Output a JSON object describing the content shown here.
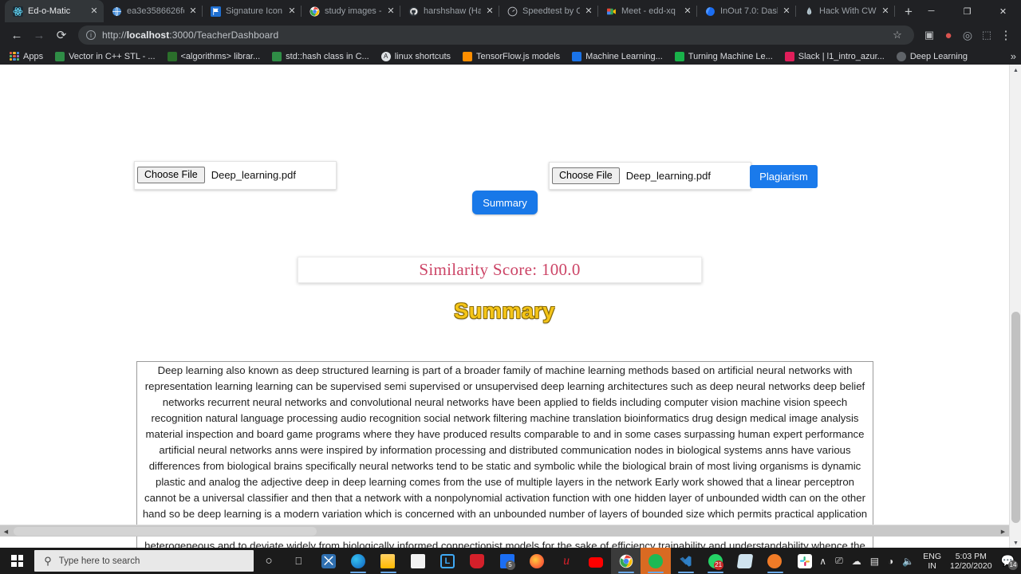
{
  "browser": {
    "tabs": [
      {
        "title": "Ed-o-Matic",
        "favicon": "react-atom-icon",
        "color": "#61dafb",
        "active": true
      },
      {
        "title": "ea3e3586626fc",
        "favicon": "globe-icon",
        "color": "#4a90d9",
        "active": false
      },
      {
        "title": "Signature Icon",
        "favicon": "flag-icon",
        "color": "#1f6fd0",
        "active": false
      },
      {
        "title": "study images -",
        "favicon": "chrome-icon",
        "color": "#4285f4",
        "active": false
      },
      {
        "title": "harshshaw (Ha",
        "favicon": "github-icon",
        "color": "#e0e0e0",
        "active": false
      },
      {
        "title": "Speedtest by O",
        "favicon": "speedtest-icon",
        "color": "#b0b3b8",
        "active": false
      },
      {
        "title": "Meet - edd-xq",
        "favicon": "meet-icon",
        "color": "#ea4335",
        "active": false
      },
      {
        "title": "InOut 7.0: Dash",
        "favicon": "inout-icon",
        "color": "#1b6ef3",
        "active": false
      },
      {
        "title": "Hack With CW",
        "favicon": "hack-icon",
        "color": "#b6c7cf",
        "active": false
      }
    ],
    "new_tab_label": "+",
    "window_controls": {
      "minimize": "─",
      "maximize": "❐",
      "close": "✕"
    },
    "nav": {
      "back": "←",
      "forward": "→",
      "reload": "⟳"
    },
    "omnibox": {
      "info_glyph": "i",
      "url_prefix": "http://",
      "url_host": "localhost",
      "url_rest": ":3000/TeacherDashboard",
      "full_url": "http://localhost:3000/TeacherDashboard",
      "star_icon": "☆"
    },
    "toolbar_icons": [
      {
        "name": "extension-puzzle-icon",
        "glyph": "▣",
        "color": "#9aa0a6"
      },
      {
        "name": "profile-avatar-icon",
        "glyph": "●",
        "color": "#d9534f"
      },
      {
        "name": "sync-icon",
        "glyph": "◎",
        "color": "#9aa0a6"
      },
      {
        "name": "extensions-icon",
        "glyph": "⬚",
        "color": "#9aa0a6"
      },
      {
        "name": "menu-kebab-icon",
        "glyph": "⋮",
        "color": "#cfd2d4"
      }
    ],
    "bookmarks": [
      {
        "label": "Apps",
        "icon": "apps-grid-icon",
        "color": "#e05a4a"
      },
      {
        "label": "Vector in C++ STL - ...",
        "icon": "geeksforgeeks-icon",
        "color": "#2f8d46"
      },
      {
        "label": "<algorithms> librar...",
        "icon": "cplusplus-icon",
        "color": "#2b6f2b"
      },
      {
        "label": "std::hash class in C...",
        "icon": "geeksforgeeks-icon",
        "color": "#2f8d46"
      },
      {
        "label": "linux shortcuts",
        "icon": "doc-a-icon",
        "color": "#dfe3e6"
      },
      {
        "label": "TensorFlow.js models",
        "icon": "tensorflow-icon",
        "color": "#ff8f00"
      },
      {
        "label": "Machine Learning...",
        "icon": "drive-icon",
        "color": "#1a73e8"
      },
      {
        "label": "Turning Machine Le...",
        "icon": "rstudio-icon",
        "color": "#19b24a"
      },
      {
        "label": "Slack | l1_intro_azur...",
        "icon": "slack-icon",
        "color": "#e01e5a"
      },
      {
        "label": "Deep Learning",
        "icon": "globe-icon",
        "color": "#5f6368"
      }
    ],
    "bookmarks_overflow": "»"
  },
  "page": {
    "upload_left": {
      "choose_label": "Choose File",
      "file_name": "Deep_learning.pdf"
    },
    "upload_right": {
      "choose_label": "Choose File",
      "file_name": "Deep_learning.pdf"
    },
    "plagiarism_button": "Plagiarism",
    "summary_button": "Summary",
    "similarity": {
      "text": "Similarity Score: 100.0",
      "label": "Similarity Score:",
      "value": "100.0",
      "color": "#cc4466"
    },
    "summary_heading": "Summary",
    "summary_heading_color": "#f5c518",
    "summary_text": "Deep learning also known as deep structured learning is part of a broader family of machine learning methods based on artificial neural networks with representation learning learning can be supervised semi supervised or unsupervised deep learning architectures such as deep neural networks deep belief networks recurrent neural networks and convolutional neural networks have been applied to fields including computer vision machine vision speech recognition natural language processing audio recognition social network filtering machine translation bioinformatics drug design medical image analysis material inspection and board game programs where they have produced results comparable to and in some cases surpassing human expert performance artificial neural networks anns were inspired by information processing and distributed communication nodes in biological systems anns have various differences from biological brains specifically neural networks tend to be static and symbolic while the biological brain of most living organisms is dynamic plastic and analog the adjective deep in deep learning comes from the use of multiple layers in the network Early work showed that a linear perceptron cannot be a universal classifier and then that a network with a nonpolynomial activation function with one hidden layer of unbounded width can on the other hand so be deep learning is a modern variation which is concerned with an unbounded number of layers of bounded size which permits practical application and optimized implementation while retaining theoretical universality under mild conditions in deep learning the layers are also permitted to be heterogeneous and to deviate widely from biologically informed connectionist models for the sake of efficiency trainability and understandability whence the structured part",
    "scroll": {
      "up_arrow": "▲",
      "down_arrow": "▼",
      "left_arrow": "◀",
      "right_arrow": "▶"
    }
  },
  "taskbar": {
    "start_label": "start-button",
    "search_placeholder": "Type here to search",
    "search_icon": "⌕",
    "items": [
      {
        "name": "cortana-icon",
        "glyph": "○",
        "color": "#e8e8e8",
        "running": false
      },
      {
        "name": "task-view-icon",
        "glyph": "⬚",
        "color": "#e8e8e8",
        "running": false
      },
      {
        "name": "snipping-tool-icon",
        "glyph": "✂",
        "color": "#2f6fb0",
        "running": false
      },
      {
        "name": "edge-icon",
        "glyph": "",
        "color": "#1a8fd1",
        "running": true
      },
      {
        "name": "file-explorer-icon",
        "glyph": "",
        "color": "#ffb900",
        "running": true
      },
      {
        "name": "microsoft-store-icon",
        "glyph": "",
        "color": "#e8e8e8",
        "running": false
      },
      {
        "name": "libre-office-icon",
        "glyph": "L",
        "color": "#3fa9f5",
        "running": false
      },
      {
        "name": "avast-icon",
        "glyph": "",
        "color": "#d4202a",
        "running": false
      },
      {
        "name": "mail-icon",
        "glyph": "",
        "color": "#1b6ef3",
        "running": false,
        "badge": "5"
      },
      {
        "name": "firefox-icon",
        "glyph": "",
        "color": "#ff7139",
        "running": false
      },
      {
        "name": "ulauncher-icon",
        "glyph": "u",
        "color": "#d4202a",
        "running": false
      },
      {
        "name": "youtube-icon",
        "glyph": "",
        "color": "#ff0000",
        "running": false
      },
      {
        "name": "chrome-icon",
        "glyph": "",
        "color": "#4285f4",
        "running": true,
        "active": true
      },
      {
        "name": "spotify-icon",
        "glyph": "",
        "color": "#1db954",
        "running": true,
        "highlight": true
      },
      {
        "name": "vscode-icon",
        "glyph": "",
        "color": "#2f80c7",
        "running": true
      },
      {
        "name": "whatsapp-icon",
        "glyph": "",
        "color": "#25d366",
        "running": true,
        "badge": "21"
      },
      {
        "name": "paper-app-icon",
        "glyph": "",
        "color": "#cfe3ee",
        "running": false
      },
      {
        "name": "orange-app-icon",
        "glyph": "",
        "color": "#f07b27",
        "running": true
      },
      {
        "name": "slack-icon",
        "glyph": "",
        "color": "#e01e5a",
        "running": false
      }
    ],
    "tray": {
      "overflow_arrow": "∧",
      "icons": [
        {
          "name": "onedrive-cloud-icon",
          "glyph": "☁"
        },
        {
          "name": "battery-icon",
          "glyph": "▮"
        },
        {
          "name": "wifi-icon",
          "glyph": "◠"
        },
        {
          "name": "volume-icon",
          "glyph": "◂"
        }
      ],
      "language": "ENG",
      "region": "IN",
      "time": "5:03 PM",
      "date": "12/20/2020",
      "notification_count": "14",
      "notification_icon": "▤"
    }
  }
}
